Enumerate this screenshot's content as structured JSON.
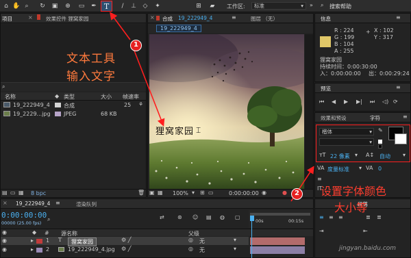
{
  "colors": {
    "accent_blue": "#2aa3e6",
    "annotation_red": "#ff1f1f",
    "annotation_text_orange": "#ff7a3d",
    "track_bar": "#b36b6b"
  },
  "toolbar": {
    "icons": [
      "home-icon",
      "hand-icon",
      "zoom-icon",
      "rotate-icon",
      "camera-icon",
      "pan-behind-icon",
      "rectangle-icon",
      "pen-icon",
      "type-tool-icon",
      "brush-icon",
      "clone-stamp-icon",
      "eraser-icon",
      "puppet-icon"
    ],
    "workspace_label": "工作区:",
    "workspace_value": "标准",
    "search_placeholder": "搜索帮助"
  },
  "project_panel": {
    "tab_project": "项目",
    "tab_effects": "效果控件 狸窝家园",
    "columns": {
      "name": "名称",
      "type": "类型",
      "size": "大小",
      "fps": "帧速率"
    },
    "items": [
      {
        "name": "19_222949_4",
        "type": "合成",
        "size": "",
        "fps": "25"
      },
      {
        "name": "19_2229...jpg",
        "type": "JPEG",
        "size": "68 KB",
        "fps": ""
      }
    ],
    "bpc": "8 bpc"
  },
  "comp_panel": {
    "tab_label": "合成",
    "tab_comp_name": "19_222949_4",
    "tab_layer": "图层 （无）",
    "breadcrumb": "19_222949_4",
    "canvas_text": "狸窝家园",
    "zoom": "100%",
    "timecode": "0:00:00:00"
  },
  "info_panel": {
    "tab": "信息",
    "r": "R : 224",
    "g": "G : 199",
    "b": "B : 104",
    "a": "A : 255",
    "x": "X : 102",
    "y": "Y : 317",
    "layer_name": "狸窝家园",
    "duration": "持续时间：0:00:30:00",
    "in_point": "入：0:00:00:00",
    "out_point": "出：0:00:29:24"
  },
  "preview_panel": {
    "tab": "预览"
  },
  "character_panel": {
    "tab_effects": "效果和预设",
    "tab_character": "字符",
    "font": "楷体",
    "size": "22 像素",
    "leading": "自动",
    "tracking_label": "度量标准",
    "tracking_value": "0"
  },
  "timeline": {
    "tab_comp": "19_222949_4",
    "tab_render": "渲染队列",
    "timecode": "0:00:00:00",
    "fps": "00000 (25.00 fps)",
    "col_source": "源名称",
    "col_parent": "父级",
    "ruler_start": "00s",
    "ruler_end": "00:15s",
    "layers": [
      {
        "num": "1",
        "name": "狸窝家园",
        "parent": "无"
      },
      {
        "num": "2",
        "name": "19_222949_4.jpg",
        "parent": "无"
      }
    ]
  },
  "right_bottom": {
    "tab": "段落"
  },
  "annotations": {
    "marker1": "1",
    "marker2": "2",
    "note1_line1": "文本工具",
    "note1_line2": "输入文字",
    "note2_line1": "设置字体颜色",
    "note2_line2": "大小等"
  },
  "watermark": "jingyan.baidu.com"
}
